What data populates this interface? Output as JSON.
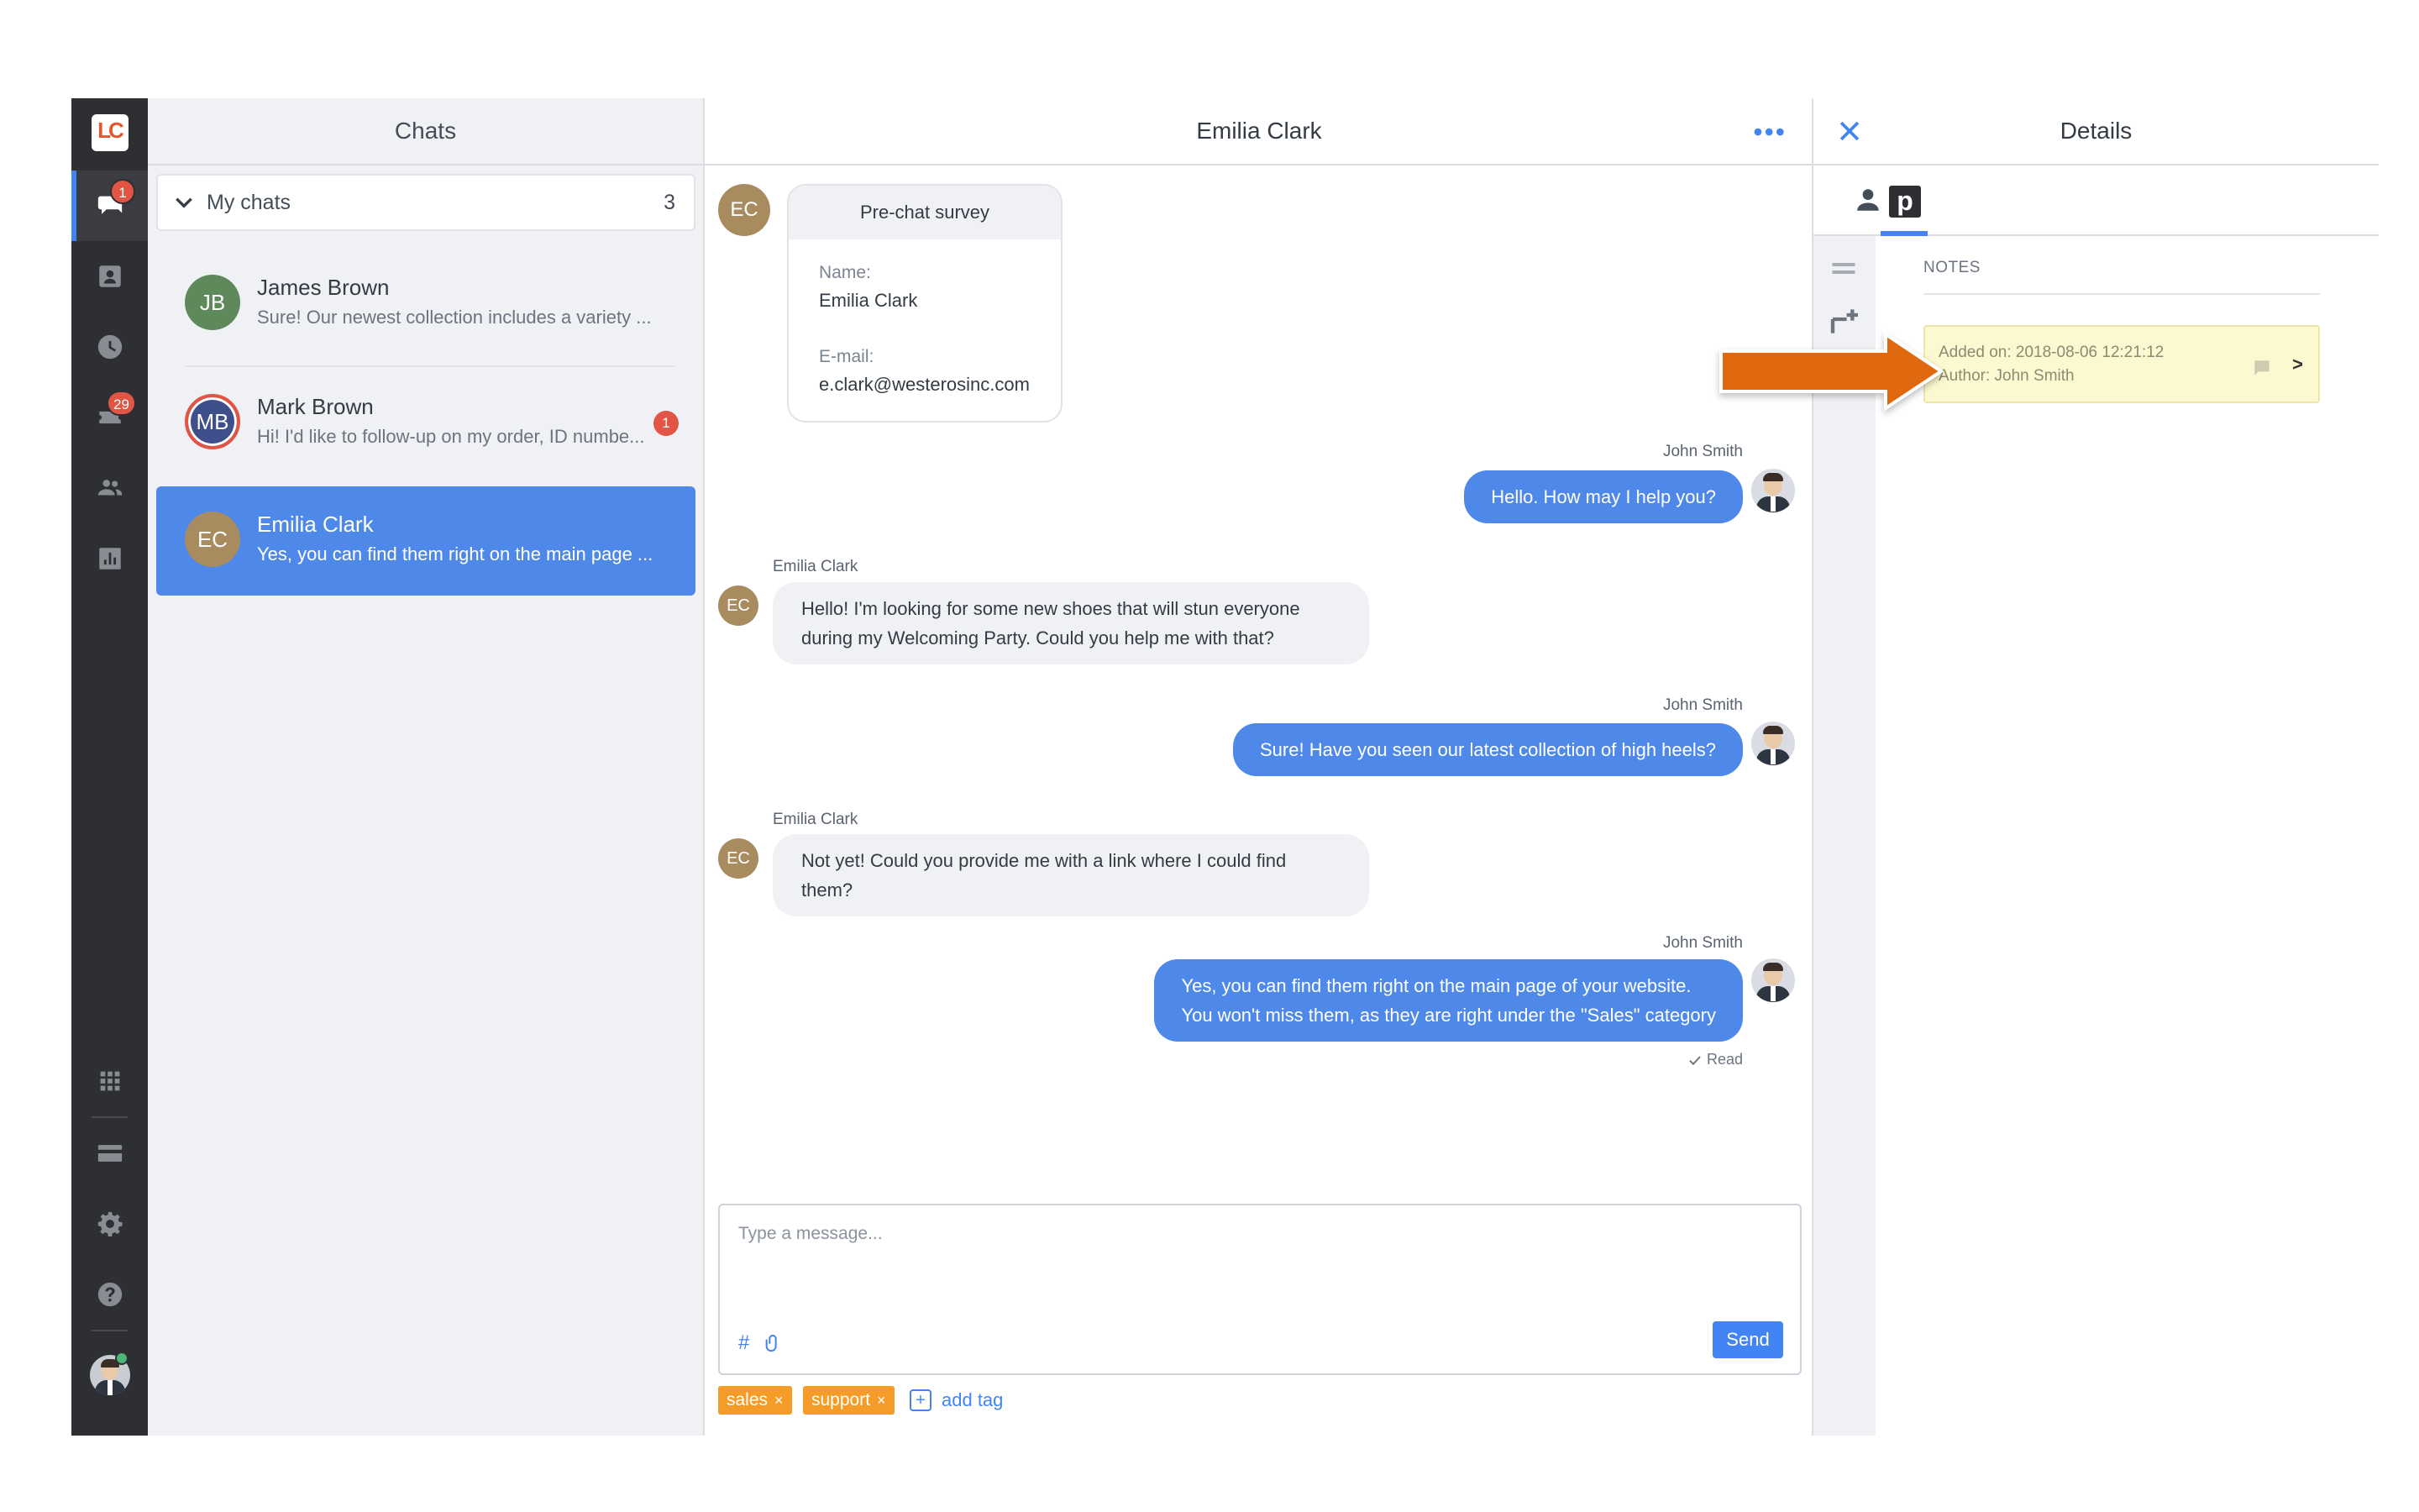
{
  "app": {
    "logo_text": "LC",
    "brand_color": "#e4572e",
    "accent": "#4384f5"
  },
  "rail": {
    "items": [
      {
        "icon": "chats-icon",
        "badge": "1",
        "active": true
      },
      {
        "icon": "customers-icon"
      },
      {
        "icon": "history-icon"
      },
      {
        "icon": "tickets-icon",
        "badge": "29"
      },
      {
        "icon": "agents-icon"
      },
      {
        "icon": "reports-icon"
      },
      {
        "icon": "apps-grid-icon"
      },
      {
        "icon": "billing-icon"
      },
      {
        "icon": "settings-icon"
      },
      {
        "icon": "help-icon"
      },
      {
        "icon": "user-avatar"
      }
    ]
  },
  "chats": {
    "title": "Chats",
    "filter": {
      "label": "My chats",
      "count": "3"
    },
    "items": [
      {
        "initials": "JB",
        "name": "James Brown",
        "preview": "Sure! Our newest collection includes a variety ...",
        "color": "#5e8a5b"
      },
      {
        "initials": "MB",
        "name": "Mark Brown",
        "preview": "Hi! I'd like to follow-up on my order, ID numbe...",
        "color": "#3e4f8c",
        "unread": "1"
      },
      {
        "initials": "EC",
        "name": "Emilia Clark",
        "preview": "Yes, you can find them right on the main page ...",
        "color": "#a88c60",
        "selected": true
      }
    ]
  },
  "conversation": {
    "title": "Emilia Clark",
    "more": "•••",
    "customer_initials": "EC",
    "survey": {
      "title": "Pre-chat survey",
      "name_label": "Name:",
      "name_value": "Emilia Clark",
      "email_label": "E-mail:",
      "email_value": "e.clark@westerosinc.com"
    },
    "messages": [
      {
        "from": "agent",
        "sender": "John Smith",
        "text": "Hello. How may I help you?"
      },
      {
        "from": "customer",
        "sender": "Emilia Clark",
        "line1": "Hello! I'm looking for some new shoes that will stun everyone",
        "line2": "during my Welcoming Party. Could you help me with that?"
      },
      {
        "from": "agent",
        "sender": "John Smith",
        "text": "Sure! Have you seen our latest collection of high heels?"
      },
      {
        "from": "customer",
        "sender": "Emilia Clark",
        "line1": "Not yet! Could you provide me with a link where I could find",
        "line2": "them?"
      },
      {
        "from": "agent",
        "sender": "John Smith",
        "line1": "Yes, you can find them right on the main page of your website.",
        "line2": "You won't miss them, as they are right under the \"Sales\" category"
      }
    ],
    "read_status": "Read",
    "composer": {
      "placeholder": "Type a message...",
      "hash": "#",
      "send": "Send"
    },
    "tags": [
      {
        "label": "sales"
      },
      {
        "label": "support"
      }
    ],
    "tag_remove": "×",
    "add_tag_plus": "+",
    "add_tag_label": "add tag"
  },
  "details": {
    "title": "Details",
    "notes_header": "NOTES",
    "note": {
      "added_on": "Added on: 2018-08-06 12:21:12",
      "author": "Author: John Smith",
      "chevron": ">"
    },
    "plugin_tab_letter": "p",
    "highlight_arrow_color": "#e0680e"
  }
}
